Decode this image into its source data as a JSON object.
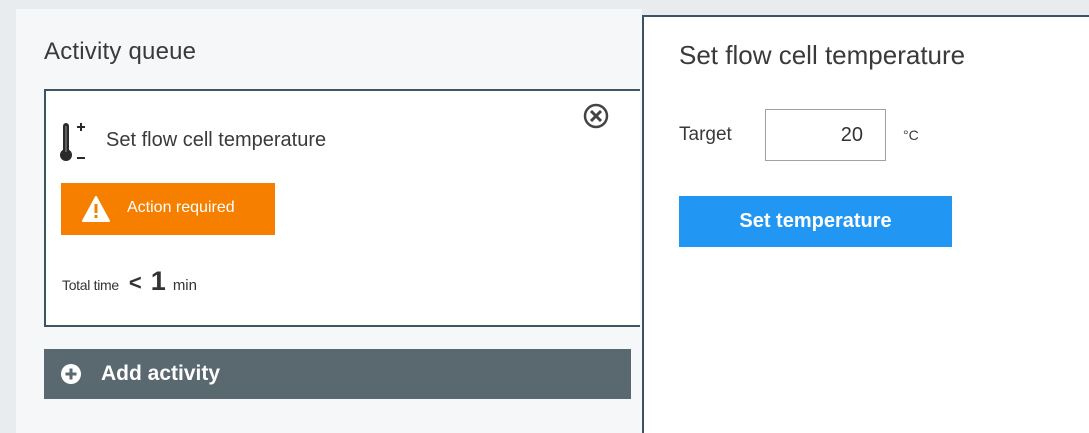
{
  "queue": {
    "title": "Activity queue",
    "card": {
      "title": "Set flow cell temperature",
      "icon": "thermometer-icon",
      "status": "Action required",
      "status_color": "#f77f00",
      "total_time_label": "Total time",
      "total_time_comparator": "<",
      "total_time_value": "1",
      "total_time_unit": "min"
    },
    "add_label": "Add activity"
  },
  "panel": {
    "title": "Set flow cell temperature",
    "target_label": "Target",
    "target_value": "20",
    "unit": "°C",
    "button_label": "Set temperature",
    "accent": "#2196f3"
  }
}
